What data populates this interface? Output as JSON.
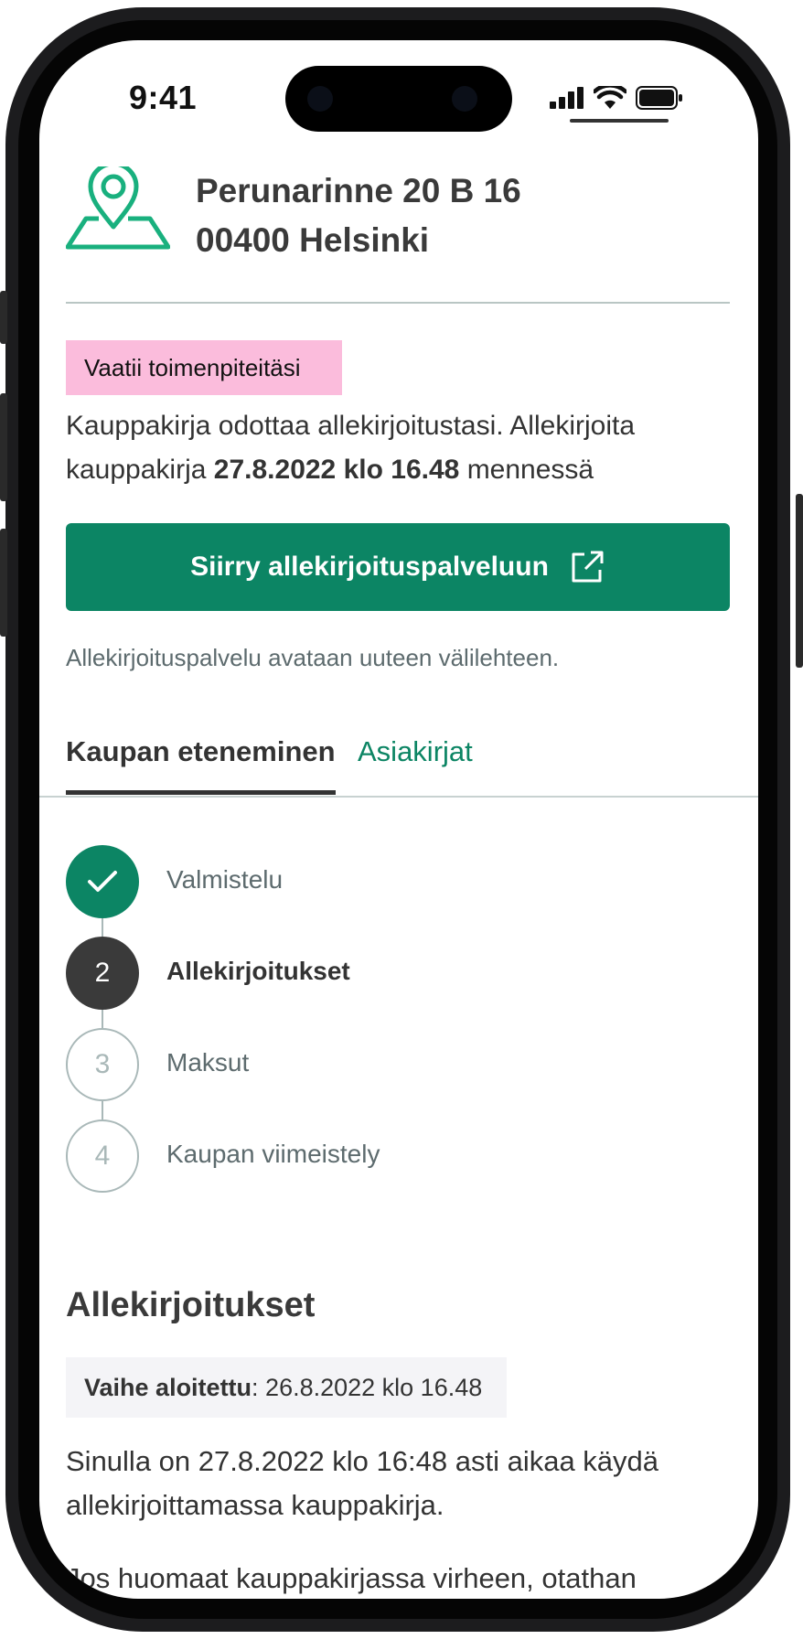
{
  "status_bar": {
    "time": "9:41"
  },
  "address": {
    "line1": "Perunarinne 20 B 16",
    "line2": "00400 Helsinki",
    "icon": "map-pin-icon",
    "icon_color": "#19b07e"
  },
  "alert": {
    "badge": "Vaatii toimenpiteitäsi",
    "badge_color": "#fbbcdc",
    "message_prefix": "Kauppakirja odottaa allekirjoitustasi. Allekirjoita kauppakirja",
    "deadline": "27.8.2022 klo 16.48",
    "message_suffix": "mennessä"
  },
  "cta": {
    "label": "Siirry allekirjoituspalveluun",
    "icon": "external-link-icon",
    "color": "#0c8564"
  },
  "note": "Allekirjoituspalvelu avataan uuteen välilehteen.",
  "tabs": [
    {
      "label": "Kaupan eteneminen",
      "active": true
    },
    {
      "label": "Asiakirjat",
      "active": false
    }
  ],
  "steps": [
    {
      "number": "1",
      "label": "Valmistelu",
      "status": "done"
    },
    {
      "number": "2",
      "label": "Allekirjoitukset",
      "status": "current"
    },
    {
      "number": "3",
      "label": "Maksut",
      "status": "todo"
    },
    {
      "number": "4",
      "label": "Kaupan viimeistely",
      "status": "todo"
    }
  ],
  "section": {
    "title": "Allekirjoitukset",
    "phase_label": "Vaihe aloitettu",
    "phase_value": ": 26.8.2022 klo 16.48",
    "paragraph1": "Sinulla on 27.8.2022 klo 16:48 asti aikaa käydä allekirjoittamassa kauppakirja.",
    "paragraph2": "Jos huomaat kauppakirjassa virheen, otathan pikaisesti yhteyttä välittäjääsi."
  }
}
